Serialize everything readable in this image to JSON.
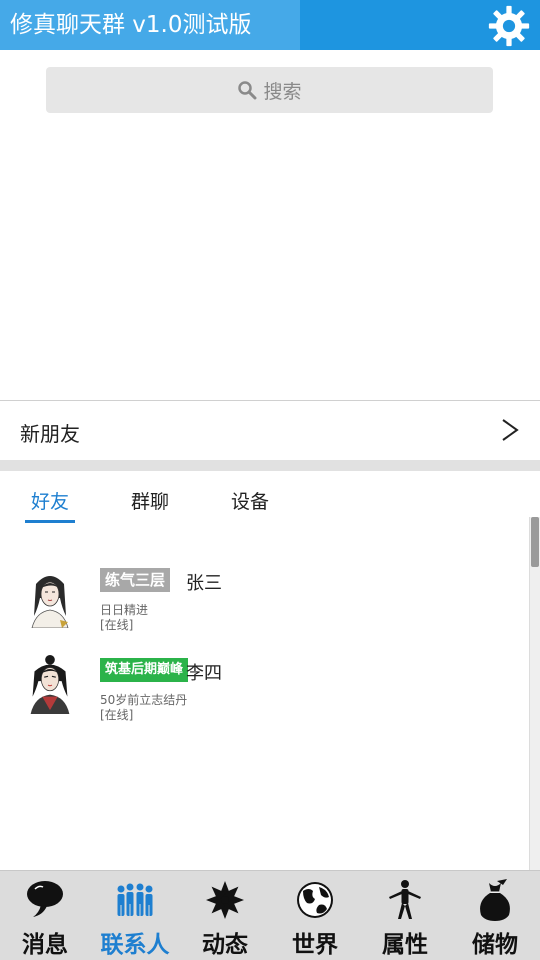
{
  "header": {
    "title": "修真聊天群 v1.0测试版",
    "settings_icon": "gear-icon"
  },
  "search": {
    "label": "搜索",
    "icon": "search-icon"
  },
  "new_friends": {
    "label": "新朋友",
    "chevron": ">"
  },
  "tabs": [
    {
      "label": "好友",
      "active": true
    },
    {
      "label": "群聊",
      "active": false
    },
    {
      "label": "设备",
      "active": false
    }
  ],
  "contacts": [
    {
      "realm": "练气三层",
      "realm_color": "#a8a8a8",
      "name": "张三",
      "motto": "日日精进",
      "status": "[在线]"
    },
    {
      "realm": "筑基后期巅峰",
      "realm_color": "#2bb34a",
      "name": "李四",
      "motto": "50岁前立志结丹",
      "status": "[在线]"
    }
  ],
  "nav": [
    {
      "label": "消息",
      "icon": "speech-bubble-icon",
      "active": false
    },
    {
      "label": "联系人",
      "icon": "people-icon",
      "active": true
    },
    {
      "label": "动态",
      "icon": "snowflake-icon",
      "active": false
    },
    {
      "label": "世界",
      "icon": "globe-icon",
      "active": false
    },
    {
      "label": "属性",
      "icon": "person-stretch-icon",
      "active": false
    },
    {
      "label": "储物",
      "icon": "bag-icon",
      "active": false
    }
  ],
  "colors": {
    "header": "#1e95e0",
    "accent": "#1e7fd0",
    "nav_bg": "#dcdcdc"
  }
}
